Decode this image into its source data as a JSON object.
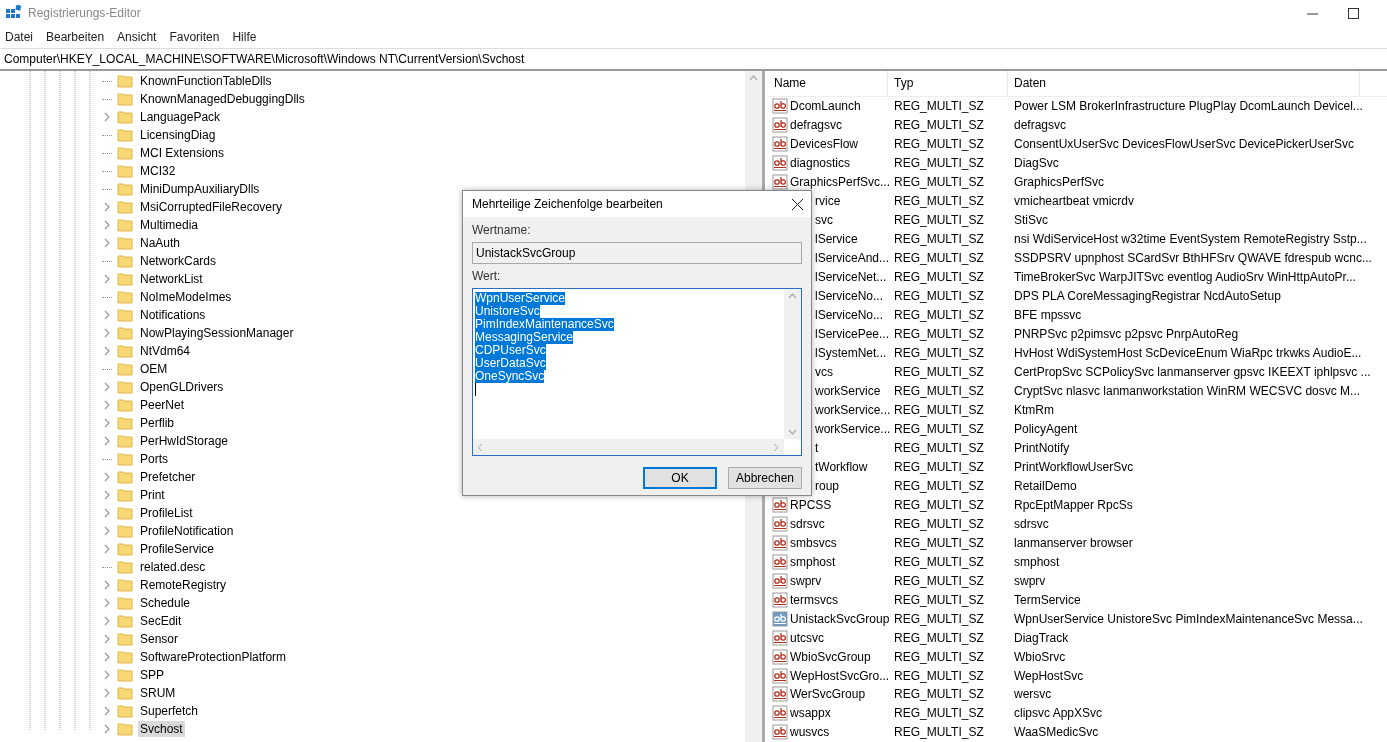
{
  "window": {
    "title": "Registrierungs-Editor"
  },
  "menu": [
    "Datei",
    "Bearbeiten",
    "Ansicht",
    "Favoriten",
    "Hilfe"
  ],
  "address": "Computer\\HKEY_LOCAL_MACHINE\\SOFTWARE\\Microsoft\\Windows NT\\CurrentVersion\\Svchost",
  "tree": {
    "items": [
      {
        "label": "KnownFunctionTableDlls",
        "expandable": false,
        "selected": false
      },
      {
        "label": "KnownManagedDebuggingDlls",
        "expandable": false,
        "selected": false
      },
      {
        "label": "LanguagePack",
        "expandable": true,
        "selected": false
      },
      {
        "label": "LicensingDiag",
        "expandable": false,
        "selected": false
      },
      {
        "label": "MCI Extensions",
        "expandable": false,
        "selected": false
      },
      {
        "label": "MCI32",
        "expandable": false,
        "selected": false
      },
      {
        "label": "MiniDumpAuxiliaryDlls",
        "expandable": false,
        "selected": false
      },
      {
        "label": "MsiCorruptedFileRecovery",
        "expandable": true,
        "selected": false
      },
      {
        "label": "Multimedia",
        "expandable": true,
        "selected": false
      },
      {
        "label": "NaAuth",
        "expandable": true,
        "selected": false
      },
      {
        "label": "NetworkCards",
        "expandable": false,
        "selected": false
      },
      {
        "label": "NetworkList",
        "expandable": true,
        "selected": false
      },
      {
        "label": "NoImeModeImes",
        "expandable": false,
        "selected": false
      },
      {
        "label": "Notifications",
        "expandable": true,
        "selected": false
      },
      {
        "label": "NowPlayingSessionManager",
        "expandable": true,
        "selected": false
      },
      {
        "label": "NtVdm64",
        "expandable": true,
        "selected": false
      },
      {
        "label": "OEM",
        "expandable": false,
        "selected": false
      },
      {
        "label": "OpenGLDrivers",
        "expandable": true,
        "selected": false
      },
      {
        "label": "PeerNet",
        "expandable": true,
        "selected": false
      },
      {
        "label": "Perflib",
        "expandable": true,
        "selected": false
      },
      {
        "label": "PerHwIdStorage",
        "expandable": true,
        "selected": false
      },
      {
        "label": "Ports",
        "expandable": false,
        "selected": false
      },
      {
        "label": "Prefetcher",
        "expandable": true,
        "selected": false
      },
      {
        "label": "Print",
        "expandable": true,
        "selected": false
      },
      {
        "label": "ProfileList",
        "expandable": true,
        "selected": false
      },
      {
        "label": "ProfileNotification",
        "expandable": true,
        "selected": false
      },
      {
        "label": "ProfileService",
        "expandable": true,
        "selected": false
      },
      {
        "label": "related.desc",
        "expandable": false,
        "selected": false
      },
      {
        "label": "RemoteRegistry",
        "expandable": true,
        "selected": false
      },
      {
        "label": "Schedule",
        "expandable": true,
        "selected": false
      },
      {
        "label": "SecEdit",
        "expandable": true,
        "selected": false
      },
      {
        "label": "Sensor",
        "expandable": true,
        "selected": false
      },
      {
        "label": "SoftwareProtectionPlatform",
        "expandable": true,
        "selected": false
      },
      {
        "label": "SPP",
        "expandable": true,
        "selected": false
      },
      {
        "label": "SRUM",
        "expandable": true,
        "selected": false
      },
      {
        "label": "Superfetch",
        "expandable": true,
        "selected": false
      },
      {
        "label": "Svchost",
        "expandable": true,
        "selected": true
      }
    ]
  },
  "table": {
    "columns": [
      "Name",
      "Typ",
      "Daten"
    ],
    "rows": [
      {
        "name": "DcomLaunch",
        "type": "REG_MULTI_SZ",
        "data": "Power LSM BrokerInfrastructure PlugPlay DcomLaunch Devicel...",
        "covered": false,
        "selected": false
      },
      {
        "name": "defragsvc",
        "type": "REG_MULTI_SZ",
        "data": "defragsvc",
        "covered": false,
        "selected": false
      },
      {
        "name": "DevicesFlow",
        "type": "REG_MULTI_SZ",
        "data": "ConsentUxUserSvc DevicesFlowUserSvc DevicePickerUserSvc",
        "covered": false,
        "selected": false
      },
      {
        "name": "diagnostics",
        "type": "REG_MULTI_SZ",
        "data": "DiagSvc",
        "covered": false,
        "selected": false
      },
      {
        "name": "GraphicsPerfSvc...",
        "type": "REG_MULTI_SZ",
        "data": "GraphicsPerfSvc",
        "covered": false,
        "selected": false
      },
      {
        "name": "rvice",
        "type": "REG_MULTI_SZ",
        "data": "vmicheartbeat vmicrdv",
        "covered": true,
        "selected": false
      },
      {
        "name": "svc",
        "type": "REG_MULTI_SZ",
        "data": "StiSvc",
        "covered": true,
        "selected": false
      },
      {
        "name": "lService",
        "type": "REG_MULTI_SZ",
        "data": "nsi WdiServiceHost w32time EventSystem RemoteRegistry Sstp...",
        "covered": true,
        "selected": false
      },
      {
        "name": "lServiceAnd...",
        "type": "REG_MULTI_SZ",
        "data": "SSDPSRV upnphost SCardSvr BthHFSrv QWAVE fdrespub wcnc...",
        "covered": true,
        "selected": false
      },
      {
        "name": "lServiceNet...",
        "type": "REG_MULTI_SZ",
        "data": "TimeBrokerSvc WarpJITSvc eventlog AudioSrv WinHttpAutoPr...",
        "covered": true,
        "selected": false
      },
      {
        "name": "lServiceNo...",
        "type": "REG_MULTI_SZ",
        "data": "DPS PLA CoreMessagingRegistrar NcdAutoSetup",
        "covered": true,
        "selected": false
      },
      {
        "name": "lServiceNo...",
        "type": "REG_MULTI_SZ",
        "data": "BFE mpssvc",
        "covered": true,
        "selected": false
      },
      {
        "name": "lServicePee...",
        "type": "REG_MULTI_SZ",
        "data": "PNRPSvc p2pimsvc p2psvc PnrpAutoReg",
        "covered": true,
        "selected": false
      },
      {
        "name": "lSystemNet...",
        "type": "REG_MULTI_SZ",
        "data": "HvHost WdiSystemHost ScDeviceEnum WiaRpc trkwks AudioE...",
        "covered": true,
        "selected": false
      },
      {
        "name": "vcs",
        "type": "REG_MULTI_SZ",
        "data": "CertPropSvc SCPolicySvc lanmanserver gpsvc IKEEXT iphlpsvc ...",
        "covered": true,
        "selected": false
      },
      {
        "name": "workService",
        "type": "REG_MULTI_SZ",
        "data": "CryptSvc nlasvc lanmanworkstation WinRM WECSVC dosvc M...",
        "covered": true,
        "selected": false
      },
      {
        "name": "workService...",
        "type": "REG_MULTI_SZ",
        "data": "KtmRm",
        "covered": true,
        "selected": false
      },
      {
        "name": "workService...",
        "type": "REG_MULTI_SZ",
        "data": "PolicyAgent",
        "covered": true,
        "selected": false
      },
      {
        "name": "t",
        "type": "REG_MULTI_SZ",
        "data": "PrintNotify",
        "covered": true,
        "selected": false
      },
      {
        "name": "tWorkflow",
        "type": "REG_MULTI_SZ",
        "data": "PrintWorkflowUserSvc",
        "covered": true,
        "selected": false
      },
      {
        "name": "roup",
        "type": "REG_MULTI_SZ",
        "data": "RetailDemo",
        "covered": true,
        "selected": false
      },
      {
        "name": "RPCSS",
        "type": "REG_MULTI_SZ",
        "data": "RpcEptMapper RpcSs",
        "covered": false,
        "selected": false
      },
      {
        "name": "sdrsvc",
        "type": "REG_MULTI_SZ",
        "data": "sdrsvc",
        "covered": false,
        "selected": false
      },
      {
        "name": "smbsvcs",
        "type": "REG_MULTI_SZ",
        "data": "lanmanserver browser",
        "covered": false,
        "selected": false
      },
      {
        "name": "smphost",
        "type": "REG_MULTI_SZ",
        "data": "smphost",
        "covered": false,
        "selected": false
      },
      {
        "name": "swprv",
        "type": "REG_MULTI_SZ",
        "data": "swprv",
        "covered": false,
        "selected": false
      },
      {
        "name": "termsvcs",
        "type": "REG_MULTI_SZ",
        "data": "TermService",
        "covered": false,
        "selected": false
      },
      {
        "name": "UnistackSvcGroup",
        "type": "REG_MULTI_SZ",
        "data": "WpnUserService UnistoreSvc PimIndexMaintenanceSvc Messa...",
        "covered": false,
        "selected": true
      },
      {
        "name": "utcsvc",
        "type": "REG_MULTI_SZ",
        "data": "DiagTrack",
        "covered": false,
        "selected": false
      },
      {
        "name": "WbioSvcGroup",
        "type": "REG_MULTI_SZ",
        "data": "WbioSrvc",
        "covered": false,
        "selected": false
      },
      {
        "name": "WepHostSvcGro...",
        "type": "REG_MULTI_SZ",
        "data": "WepHostSvc",
        "covered": false,
        "selected": false
      },
      {
        "name": "WerSvcGroup",
        "type": "REG_MULTI_SZ",
        "data": "wersvc",
        "covered": false,
        "selected": false
      },
      {
        "name": "wsappx",
        "type": "REG_MULTI_SZ",
        "data": "clipsvc AppXSvc",
        "covered": false,
        "selected": false
      },
      {
        "name": "wusvcs",
        "type": "REG_MULTI_SZ",
        "data": "WaaSMedicSvc",
        "covered": false,
        "selected": false
      }
    ]
  },
  "dialog": {
    "title": "Mehrteilige Zeichenfolge bearbeiten",
    "name_label": "Wertname:",
    "name_value": "UnistackSvcGroup",
    "value_label": "Wert:",
    "value_lines": [
      "WpnUserService",
      "UnistoreSvc",
      "PimIndexMaintenanceSvc",
      "MessagingService",
      "CDPUserSvc",
      "UserDataSvc",
      "OneSyncSvc"
    ],
    "value_selected": true,
    "buttons": [
      "OK",
      "Abbrechen"
    ]
  }
}
